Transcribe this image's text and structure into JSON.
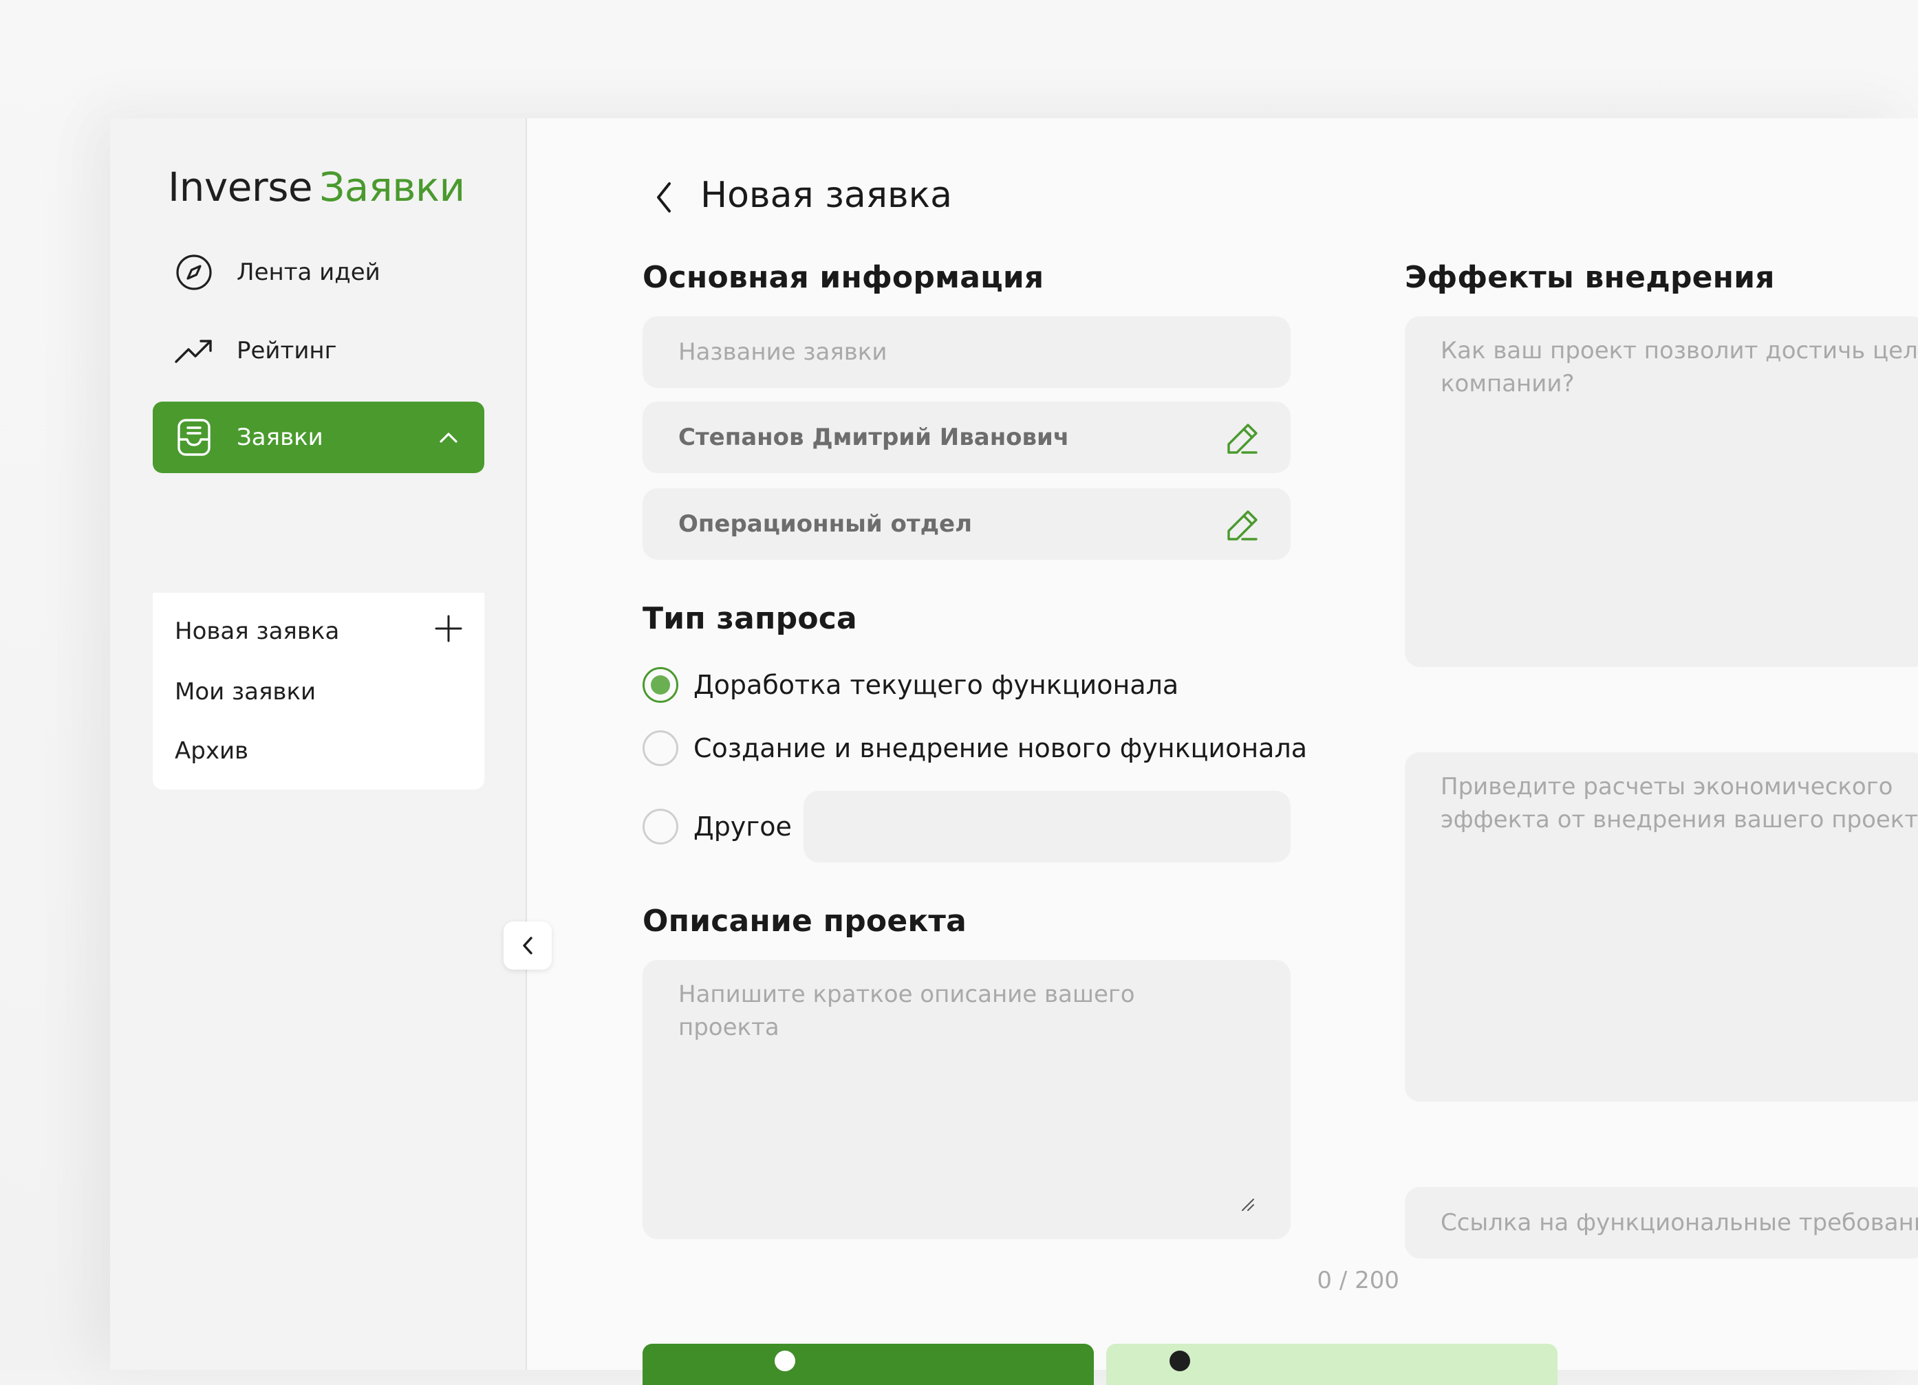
{
  "brand": {
    "part1": "Inverse",
    "part2": "Заявки"
  },
  "sidebar": {
    "items": [
      {
        "label": "Лента идей",
        "icon": "compass-icon"
      },
      {
        "label": "Рейтинг",
        "icon": "trending-up-icon"
      },
      {
        "label": "Заявки",
        "icon": "inbox-icon",
        "active": true,
        "expanded": true
      }
    ],
    "submenu": [
      {
        "label": "Новая заявка",
        "icon": "plus-icon"
      },
      {
        "label": "Мои заявки"
      },
      {
        "label": "Архив"
      }
    ]
  },
  "page": {
    "title": "Новая заявка"
  },
  "basic_info": {
    "title": "Основная информация",
    "name_placeholder": "Название заявки",
    "author": "Степанов Дмитрий Иванович",
    "department": "Операционный отдел"
  },
  "request_type": {
    "title": "Тип запроса",
    "options": [
      {
        "label": "Доработка текущего функционала",
        "checked": true
      },
      {
        "label": "Создание и внедрение нового функционала",
        "checked": false
      },
      {
        "label": "Другое",
        "checked": false
      }
    ],
    "other_value": ""
  },
  "description": {
    "title": "Описание проекта",
    "placeholder": "Напишите краткое описание вашего проекта",
    "counter": "0 / 200"
  },
  "effects": {
    "title": "Эффекты внедрения",
    "goal_placeholder": "Как ваш проект позволит достичь цели компании?",
    "economic_placeholder": "Приведите расчеты экономического эффекта от внедрения вашего проекта",
    "link_placeholder": "Ссылка на функциональные требования"
  },
  "colors": {
    "accent": "#4a9a2e",
    "accent_light": "#d3efc6",
    "field_bg": "#f0f0f0",
    "placeholder": "#a9a9a9"
  }
}
